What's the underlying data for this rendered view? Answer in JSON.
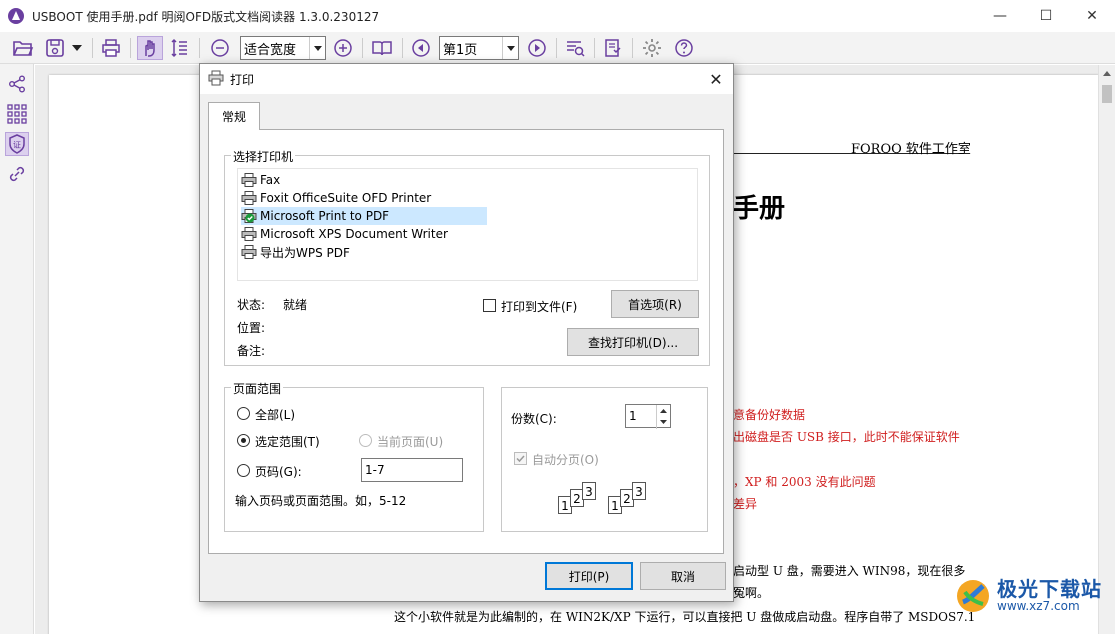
{
  "window": {
    "title": "USBOOT 使用手册.pdf 明阅OFD版式文档阅读器 1.3.0.230127",
    "minimize": "—",
    "maximize": "☐",
    "close": "✕"
  },
  "toolbar": {
    "zoom_value": "适合宽度",
    "page_value": "第1页"
  },
  "document": {
    "header_right": "FOROO 软件工作室",
    "title_fragment": "手册",
    "red_lines": [
      "意备份好数据",
      "出磁盘是否 USB 接口，此时不能保证软件",
      "，XP 和 2003 没有此问题",
      "差异"
    ],
    "body_lines": [
      "启动型 U 盘，需要进入 WIN98，现在很多",
      "冤啊。",
      "这个小软件就是为此编制的，在 WIN2K/XP 下运行，可以直接把 U 盘做成启动盘。程序自带了 MSDOS7.1"
    ]
  },
  "dialog": {
    "title": "打印",
    "close": "✕",
    "tab_general": "常规",
    "printer_group": {
      "caption": "选择打印机",
      "printers": [
        {
          "name": "Fax",
          "selected": false,
          "default": false
        },
        {
          "name": "Foxit OfficeSuite OFD Printer",
          "selected": false,
          "default": false
        },
        {
          "name": "Microsoft Print to PDF",
          "selected": true,
          "default": true
        },
        {
          "name": "Microsoft XPS Document Writer",
          "selected": false,
          "default": false
        },
        {
          "name": "导出为WPS PDF",
          "selected": false,
          "default": false
        }
      ],
      "status_label": "状态:",
      "status_value": "就绪",
      "location_label": "位置:",
      "comment_label": "备注:",
      "print_to_file": "打印到文件(F)",
      "preferences_button": "首选项(R)",
      "find_printer_button": "查找打印机(D)..."
    },
    "range_group": {
      "caption": "页面范围",
      "all": "全部(L)",
      "selection": "选定范围(T)",
      "current_page": "当前页面(U)",
      "pages": "页码(G):",
      "pages_value": "1-7",
      "hint": "输入页码或页面范围。如，5-12"
    },
    "copies": {
      "label": "份数(C):",
      "value": "1",
      "collate": "自动分页(O)",
      "collate_checked": true
    },
    "print_button": "打印(P)",
    "cancel_button": "取消"
  },
  "watermark": {
    "name": "极光下载站",
    "url": "www.xz7.com"
  },
  "colors": {
    "accent": "#6a3fa0",
    "doc_red": "#d02020",
    "selection": "#cce8ff"
  }
}
